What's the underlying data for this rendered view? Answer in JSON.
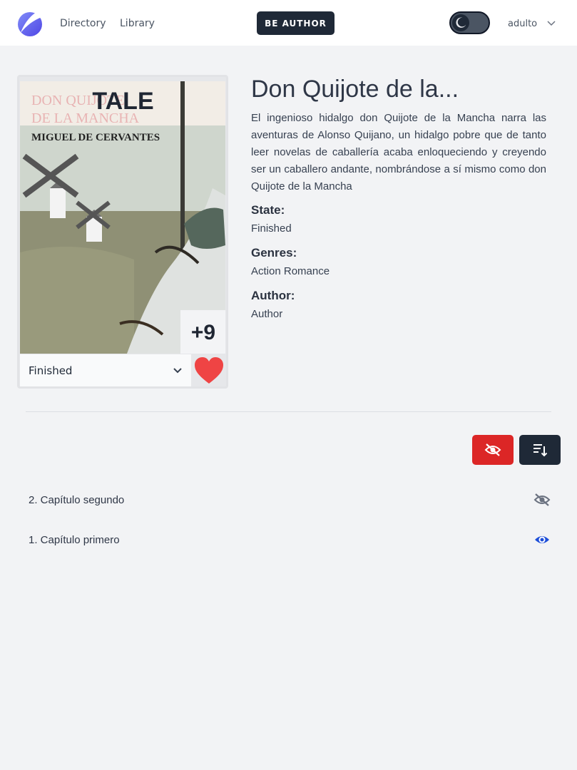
{
  "header": {
    "logo_icon": "moon-logo-icon",
    "nav": [
      "Directory",
      "Library"
    ],
    "be_author_label": "BE AUTHOR",
    "theme_toggle_icon": "moon-icon",
    "user_name": "adulto",
    "user_menu_icon": "chevron-down-icon"
  },
  "book": {
    "cover": {
      "type_label": "TALE",
      "cover_title_line1": "DON QUIJOTE",
      "cover_title_line2": "DE LA MANCHA",
      "cover_author": "MIGUEL DE CERVANTES",
      "chapter_badge": "+9"
    },
    "reading_state": "Finished",
    "favorite_icon": "heart-icon",
    "title": "Don Quijote de la...",
    "description": "El ingenioso hidalgo don Quijote de la Mancha narra las aventuras de Alonso Quijano, un hidalgo pobre que de tanto leer novelas de caballería acaba enloqueciendo y creyendo ser un caballero andante, nombrándose a sí mismo como don Quijote de la Mancha",
    "state_label": "State:",
    "state_value": "Finished",
    "genres_label": "Genres:",
    "genres_value": "Action Romance",
    "author_label": "Author:",
    "author_value": "Author"
  },
  "toolbar": {
    "hide_read_icon": "eye-slash-icon",
    "sort_icon": "sort-descending-icon",
    "colors": {
      "hide": "#dc2626",
      "sort": "#1f2937"
    }
  },
  "chapters": [
    {
      "title": "2. Capítulo segundo",
      "icon": "eye-slash-icon",
      "read": false
    },
    {
      "title": "1. Capítulo primero",
      "icon": "eye-icon",
      "read": true
    }
  ],
  "colors": {
    "accent": "#6366f1",
    "eye_active": "#1d4ed8",
    "eye_inactive": "#6b7280",
    "heart": "#ef4444"
  }
}
